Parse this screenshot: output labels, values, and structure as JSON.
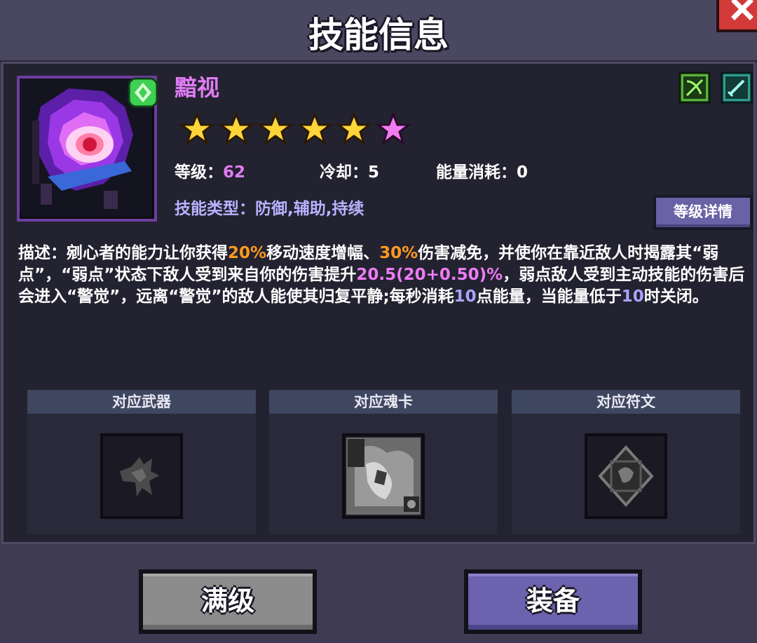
{
  "header": {
    "title": "技能信息"
  },
  "skill": {
    "name": "黯视",
    "stars_total": 6,
    "stars_gold": 5,
    "stars_pink": 1,
    "level_label": "等级：",
    "level_value": "62",
    "cooldown_label": "冷却：",
    "cooldown_value": "5",
    "energy_label": "能量消耗：",
    "energy_value": "0",
    "type_label": "技能类型：",
    "type_value": "防御,辅助,持续",
    "level_detail_button": "等级详情",
    "tags": [
      "bow-tag-icon",
      "sword-tag-icon"
    ]
  },
  "description": {
    "prefix": "描述：",
    "segments": [
      {
        "text": "剜心者的能力让你获得",
        "style": "normal"
      },
      {
        "text": "20%",
        "style": "orange"
      },
      {
        "text": "移动速度增幅、",
        "style": "normal"
      },
      {
        "text": "30%",
        "style": "orange"
      },
      {
        "text": "伤害减免，并使你在靠近敌人时揭露其“弱点”，“弱点”状态下敌人受到来自你的伤害提升",
        "style": "normal"
      },
      {
        "text": "20.5(20+0.50)%",
        "style": "pink"
      },
      {
        "text": "，弱点敌人受到主动技能的伤害后会进入“警觉”，远离“警觉”的敌人能使其归复平静;每秒消耗",
        "style": "normal"
      },
      {
        "text": "10",
        "style": "blue"
      },
      {
        "text": "点能量，当能量低于",
        "style": "normal"
      },
      {
        "text": "10",
        "style": "blue"
      },
      {
        "text": "时关闭。",
        "style": "normal"
      }
    ]
  },
  "slots": [
    {
      "label": "对应武器",
      "icon": "weapon-icon"
    },
    {
      "label": "对应魂卡",
      "icon": "soul-card-icon"
    },
    {
      "label": "对应符文",
      "icon": "rune-icon"
    }
  ],
  "buttons": {
    "max_level": "满级",
    "equip": "装备"
  },
  "colors": {
    "accent_orange": "#ff9a1f",
    "accent_pink": "#ee7cf5",
    "accent_blue": "#a9a3ff",
    "skill_name": "#e07cf5",
    "equip_button": "#6c62ad",
    "max_button": "#8c8c8c"
  }
}
